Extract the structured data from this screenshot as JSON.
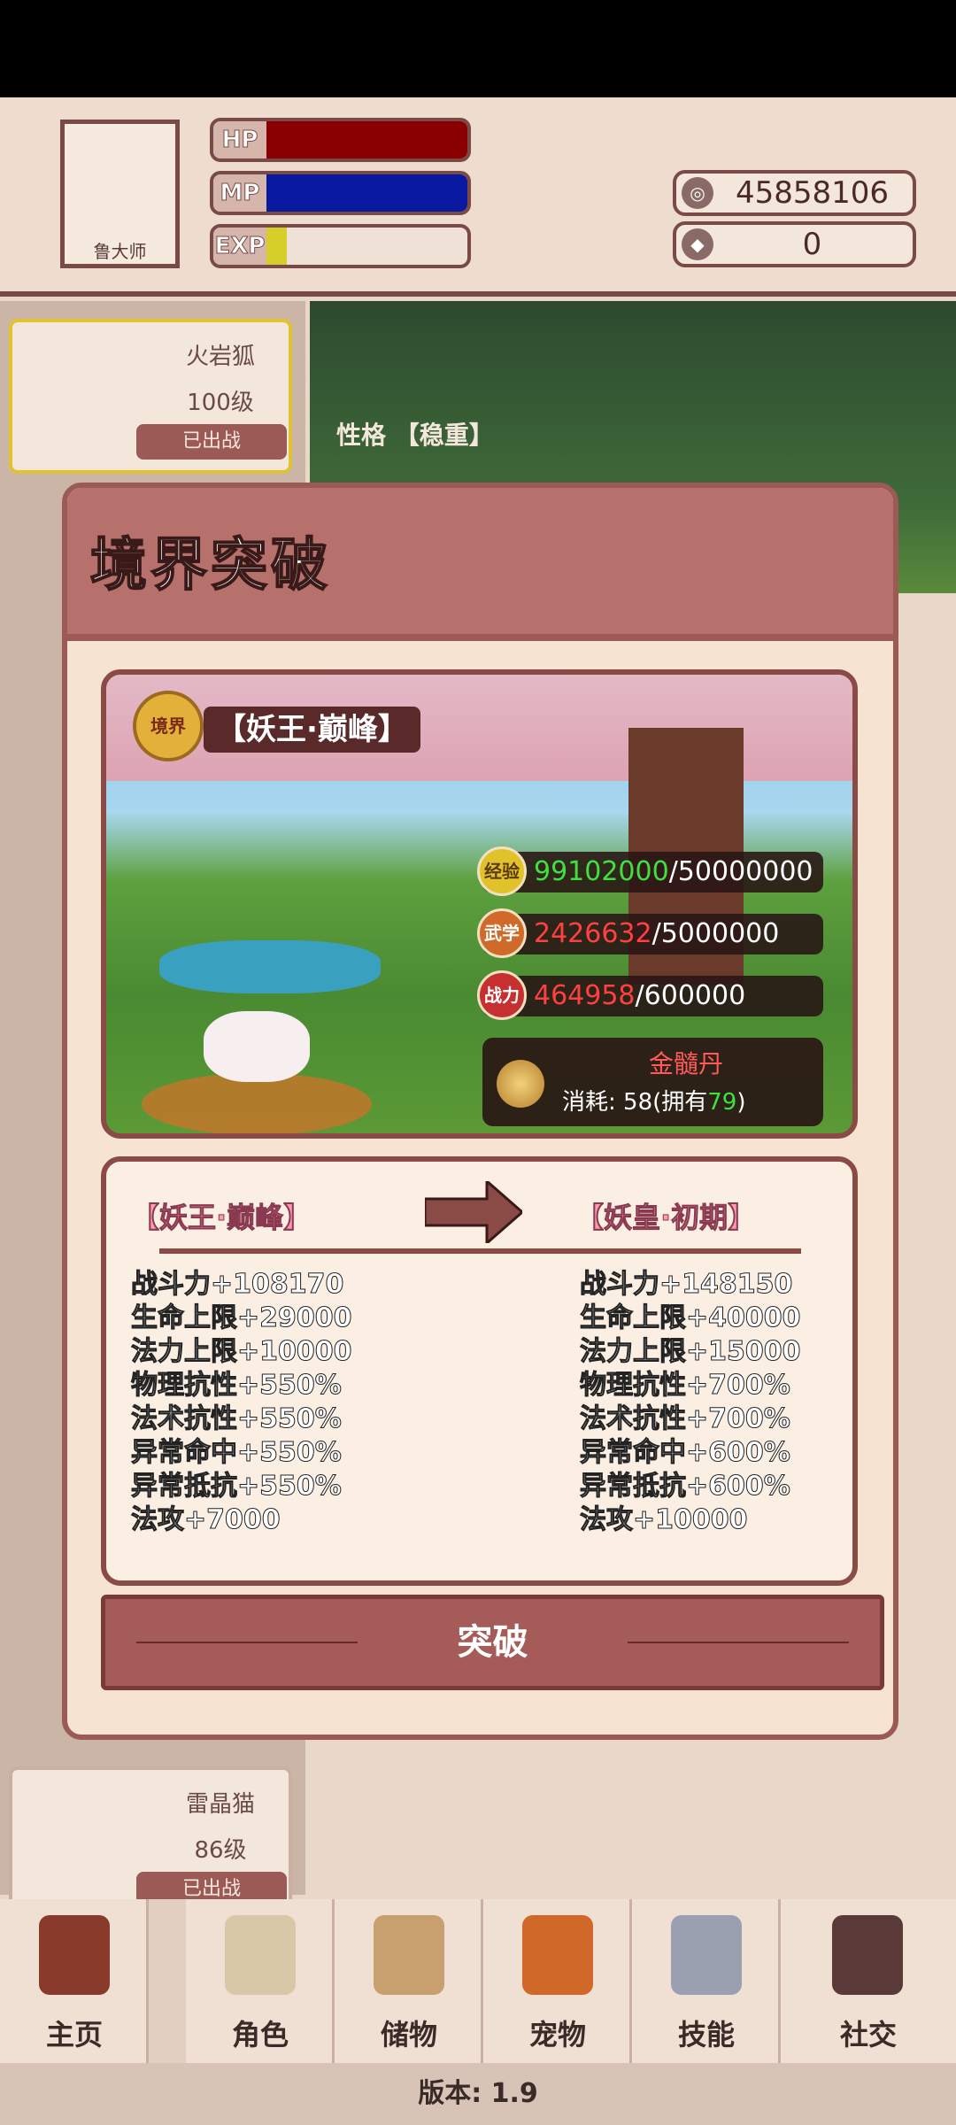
{
  "header": {
    "avatar_name": "鲁大师",
    "hp_label": "HP",
    "mp_label": "MP",
    "exp_label": "EXP",
    "hp_fill": 1.0,
    "mp_fill": 1.0,
    "exp_fill": 0.1,
    "coins": "45858106",
    "gems": "0"
  },
  "pets": [
    {
      "name": "火岩狐",
      "level": "100级",
      "status": "已出战"
    },
    {
      "name": "雷晶猫",
      "level": "86级",
      "status": "已出战"
    }
  ],
  "forest": {
    "personality_label": "性格",
    "personality": "【稳重】"
  },
  "modal": {
    "title": "境界突破",
    "badge": "境界",
    "current_realm": "【妖王·巅峰】",
    "requirements": [
      {
        "icon": "经验",
        "current": "99102000",
        "target": "/50000000"
      },
      {
        "icon": "武学",
        "current": "2426632",
        "target": "/5000000"
      },
      {
        "icon": "战力",
        "current": "464958",
        "target": "/600000"
      }
    ],
    "item": {
      "name": "金髓丹",
      "cost_prefix": "消耗: 58(拥有",
      "owned": "79",
      "cost_suffix": ")"
    },
    "compare": {
      "left_title": "【妖王·巅峰】",
      "right_title": "【妖皇·初期】",
      "left_stats": [
        "战斗力+108170",
        "生命上限+29000",
        "法力上限+10000",
        "物理抗性+550%",
        "法术抗性+550%",
        "异常命中+550%",
        "异常抵抗+550%",
        "法攻+7000"
      ],
      "right_stats": [
        "战斗力+148150",
        "生命上限+40000",
        "法力上限+15000",
        "物理抗性+700%",
        "法术抗性+700%",
        "异常命中+600%",
        "异常抵抗+600%",
        "法攻+10000"
      ]
    },
    "button": "突破"
  },
  "nav": [
    "主页",
    "角色",
    "储物",
    "宠物",
    "技能",
    "社交"
  ],
  "footer": "版本: 1.9"
}
